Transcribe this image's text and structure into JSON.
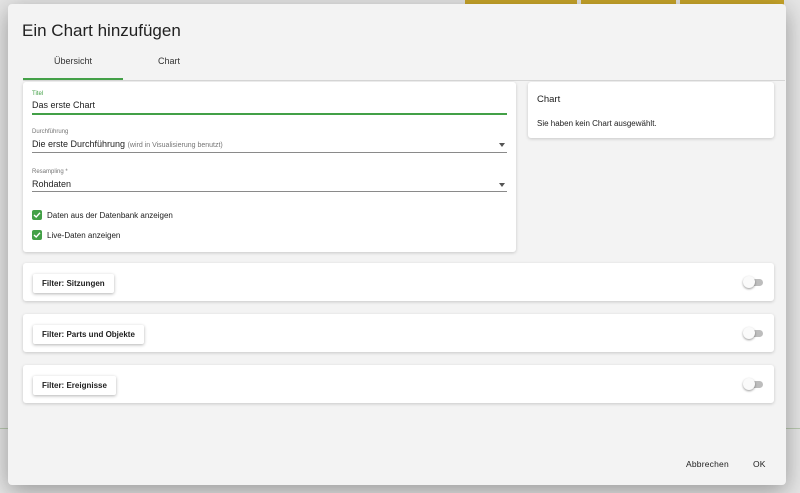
{
  "dialog": {
    "title": "Ein Chart hinzufügen",
    "tabs": [
      {
        "label": "Übersicht",
        "active": true
      },
      {
        "label": "Chart",
        "active": false
      }
    ],
    "form": {
      "title_field": {
        "label": "Titel",
        "value": "Das erste Chart"
      },
      "durchfuehrung": {
        "label": "Durchführung",
        "value": "Die erste Durchführung",
        "hint": "(wird in Visualisierung benutzt)"
      },
      "resampling": {
        "label": "Resampling *",
        "value": "Rohdaten"
      },
      "checkboxes": [
        {
          "label": "Daten aus der Datenbank anzeigen",
          "checked": true
        },
        {
          "label": "Live-Daten anzeigen",
          "checked": true
        }
      ]
    },
    "chart_panel": {
      "title": "Chart",
      "message": "Sie haben kein Chart ausgewählt."
    },
    "filters": [
      {
        "label": "Filter: Sitzungen",
        "enabled": false
      },
      {
        "label": "Filter: Parts und Objekte",
        "enabled": false
      },
      {
        "label": "Filter: Ereignisse",
        "enabled": false
      }
    ],
    "footer": {
      "cancel_label": "Abbrechen",
      "ok_label": "OK"
    }
  },
  "colors": {
    "accent": "#43a047",
    "background": "#f3f3f3",
    "card": "#ffffff"
  }
}
